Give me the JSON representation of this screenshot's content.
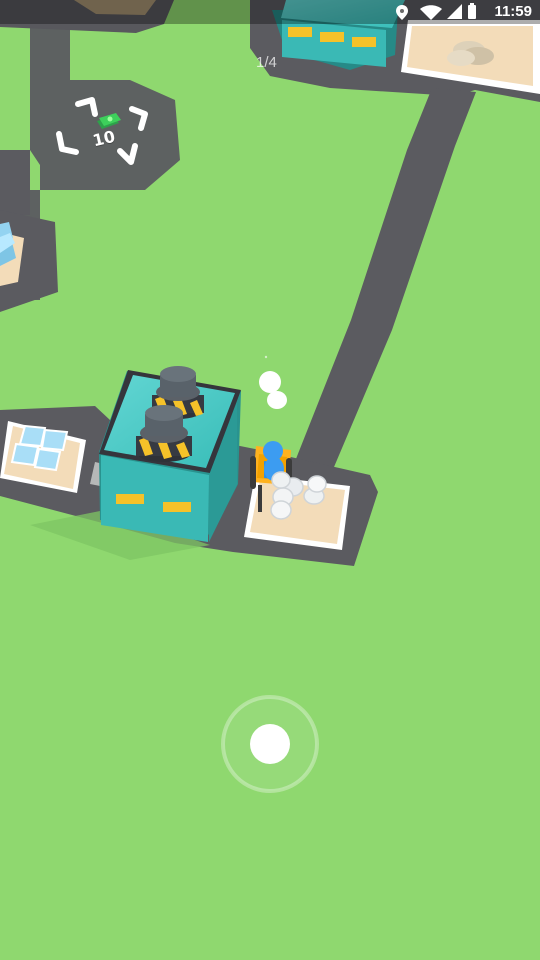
{
  "status_bar": {
    "time": "11:59",
    "icons": [
      "location-icon",
      "wifi-icon",
      "signal-icon",
      "battery-icon"
    ]
  },
  "hud": {
    "level_progress": "1/4"
  },
  "buy_spot": {
    "cash_amount": "10",
    "icon": "cash-icon"
  },
  "colors": {
    "grass": "#8fd86f",
    "road": "#5a5a5f",
    "factory_teal": "#3ab9b5",
    "window_yellow": "#f5c229",
    "pad_sand": "#f3dcb9",
    "worker_blue": "#3c9cf1",
    "product_white": "#ffffff"
  }
}
